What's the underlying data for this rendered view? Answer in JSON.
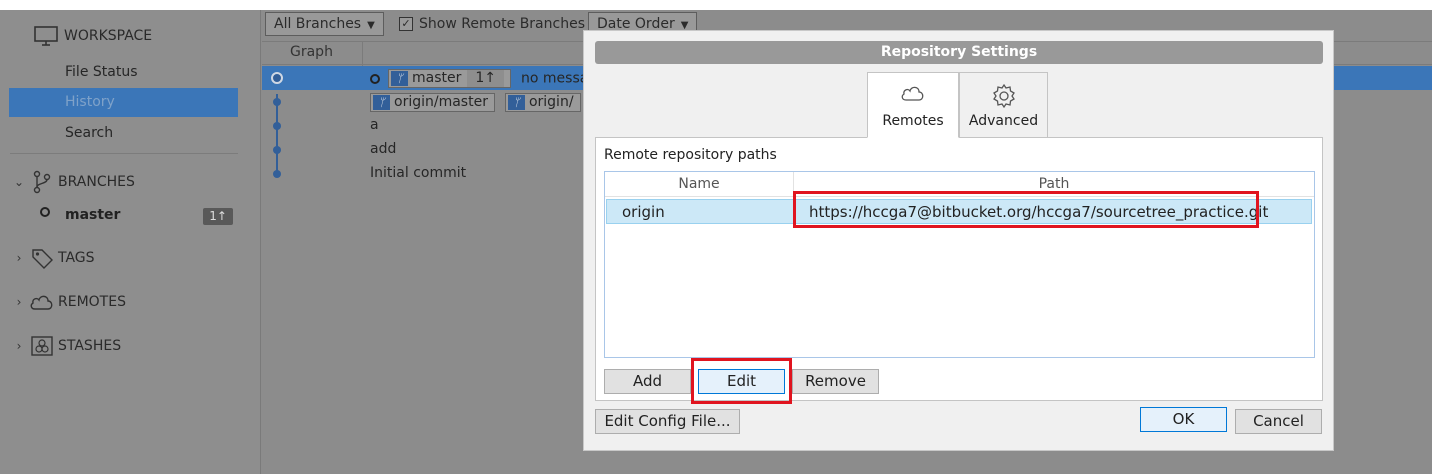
{
  "sidebar": {
    "workspace_label": "WORKSPACE",
    "items": [
      {
        "label": "File Status"
      },
      {
        "label": "History"
      },
      {
        "label": "Search"
      }
    ],
    "branches_label": "BRANCHES",
    "branch": {
      "name": "master",
      "badge": "1↑"
    },
    "tags_label": "TAGS",
    "remotes_label": "REMOTES",
    "stashes_label": "STASHES"
  },
  "toolbar": {
    "branches_dropdown": "All Branches",
    "show_remote_label": "Show Remote Branches",
    "order_dropdown": "Date Order"
  },
  "history": {
    "graph_header": "Graph",
    "rows": [
      {
        "branch_tag": "master",
        "count": "1↑",
        "message": "no messag"
      },
      {
        "tag1": "origin/master",
        "tag2": "origin/"
      },
      {
        "message": "a"
      },
      {
        "message": "add"
      },
      {
        "message": "Initial commit"
      }
    ]
  },
  "dialog": {
    "title": "Repository Settings",
    "tabs": [
      {
        "label": "Remotes",
        "icon": "cloud-icon"
      },
      {
        "label": "Advanced",
        "icon": "gear-icon"
      }
    ],
    "panel_title": "Remote repository paths",
    "columns": [
      "Name",
      "Path"
    ],
    "remotes": [
      {
        "name": "origin",
        "path": "https://hccga7@bitbucket.org/hccga7/sourcetree_practice.git"
      }
    ],
    "buttons": {
      "add": "Add",
      "edit": "Edit",
      "remove": "Remove",
      "edit_config": "Edit Config File...",
      "ok": "OK",
      "cancel": "Cancel"
    }
  },
  "colors": {
    "selection": "#3b76b8",
    "highlight_box": "#e0141f",
    "row_selected": "#cce8f7"
  }
}
